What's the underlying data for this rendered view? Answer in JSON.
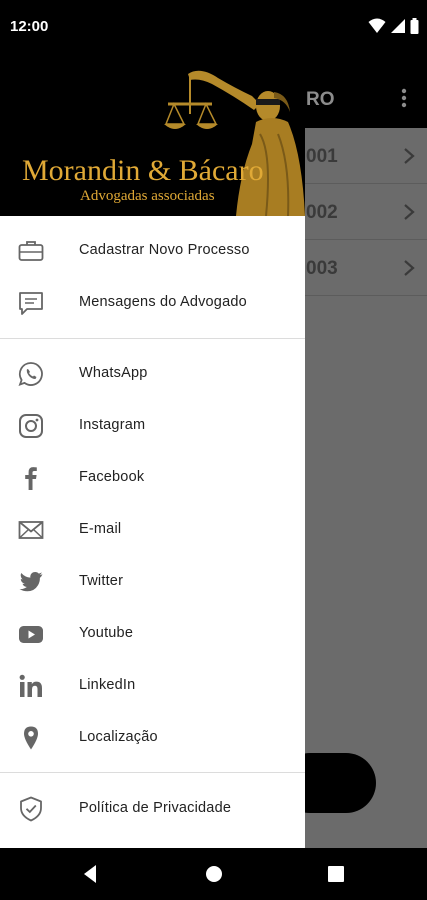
{
  "status_bar": {
    "time": "12:00",
    "icons": [
      "wifi-icon",
      "signal-icon",
      "battery-icon"
    ]
  },
  "app": {
    "title_partial": "RO",
    "rows": [
      {
        "label": "001"
      },
      {
        "label": "002"
      },
      {
        "label": "003"
      }
    ]
  },
  "drawer": {
    "brand": {
      "name": "Morandin & Bácaro",
      "subtitle": "Advogadas associadas",
      "color": "#e0a936"
    },
    "section1": [
      {
        "label": "Cadastrar Novo Processo",
        "icon": "briefcase-icon"
      },
      {
        "label": "Mensagens do Advogado",
        "icon": "message-icon"
      }
    ],
    "section2": [
      {
        "label": "WhatsApp",
        "icon": "whatsapp-icon"
      },
      {
        "label": "Instagram",
        "icon": "instagram-icon"
      },
      {
        "label": "Facebook",
        "icon": "facebook-icon"
      },
      {
        "label": "E-mail",
        "icon": "email-icon"
      },
      {
        "label": "Twitter",
        "icon": "twitter-icon"
      },
      {
        "label": "Youtube",
        "icon": "youtube-icon"
      },
      {
        "label": "LinkedIn",
        "icon": "linkedin-icon"
      },
      {
        "label": "Localização",
        "icon": "location-icon"
      }
    ],
    "section3": [
      {
        "label": "Política de Privacidade",
        "icon": "shield-icon"
      }
    ]
  },
  "navbar": {
    "buttons": [
      "back-icon",
      "home-icon",
      "recents-icon"
    ]
  }
}
